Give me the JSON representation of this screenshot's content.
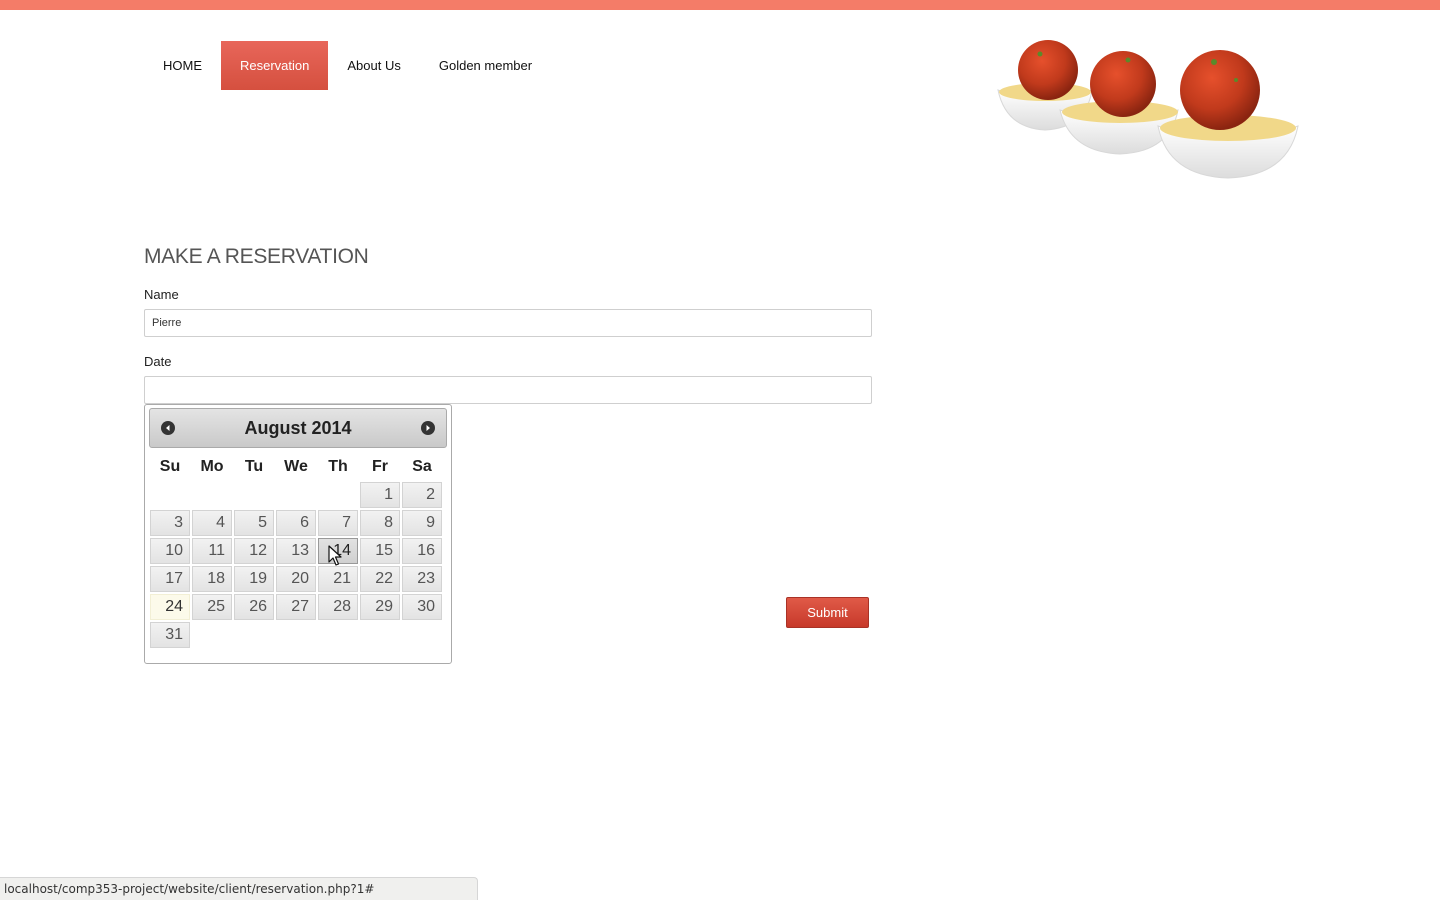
{
  "nav": {
    "items": [
      {
        "label": "HOME",
        "active": false
      },
      {
        "label": "Reservation",
        "active": true
      },
      {
        "label": "About Us",
        "active": false
      },
      {
        "label": "Golden member",
        "active": false
      }
    ]
  },
  "hero": {
    "icon": "spaghetti-meatballs-image"
  },
  "form": {
    "title": "MAKE A RESERVATION",
    "name_label": "Name",
    "name_value": "Pierre",
    "date_label": "Date",
    "date_value": "",
    "submit_label": "Submit"
  },
  "datepicker": {
    "title": "August 2014",
    "prev_icon": "chevron-left-icon",
    "next_icon": "chevron-right-icon",
    "weekdays": [
      "Su",
      "Mo",
      "Tu",
      "We",
      "Th",
      "Fr",
      "Sa"
    ],
    "weeks": [
      [
        "",
        "",
        "",
        "",
        "",
        "1",
        "2"
      ],
      [
        "3",
        "4",
        "5",
        "6",
        "7",
        "8",
        "9"
      ],
      [
        "10",
        "11",
        "12",
        "13",
        "14",
        "15",
        "16"
      ],
      [
        "17",
        "18",
        "19",
        "20",
        "21",
        "22",
        "23"
      ],
      [
        "24",
        "25",
        "26",
        "27",
        "28",
        "29",
        "30"
      ],
      [
        "31",
        "",
        "",
        "",
        "",
        "",
        ""
      ]
    ],
    "today": "24",
    "hovered": "14"
  },
  "status_bar": {
    "url": "localhost/comp353-project/website/client/reservation.php?1#"
  },
  "colors": {
    "accent": "#f47c68",
    "button": "#d5503f"
  }
}
